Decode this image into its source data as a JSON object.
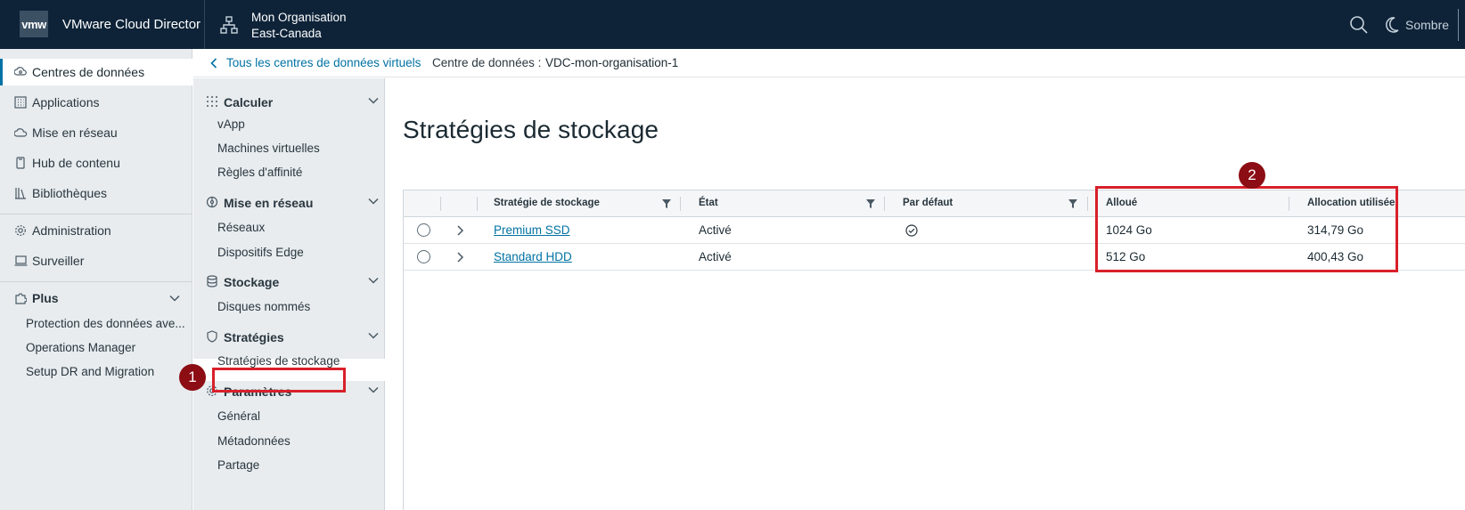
{
  "header": {
    "logo": "vmw",
    "app_name": "VMware Cloud Director",
    "org_line1": "Mon Organisation",
    "org_line2": "East-Canada",
    "theme_label": "Sombre"
  },
  "leftnav": {
    "items": [
      {
        "label": "Centres de données",
        "icon": "datacenter-icon"
      },
      {
        "label": "Applications",
        "icon": "applications-icon"
      },
      {
        "label": "Mise en réseau",
        "icon": "cloud-network-icon"
      },
      {
        "label": "Hub de contenu",
        "icon": "content-hub-icon"
      },
      {
        "label": "Bibliothèques",
        "icon": "libraries-icon"
      },
      {
        "label": "Administration",
        "icon": "gear-icon"
      },
      {
        "label": "Surveiller",
        "icon": "monitor-icon"
      }
    ],
    "plus_label": "Plus",
    "plus_items": [
      "Protection des données ave...",
      "Operations Manager",
      "Setup DR and Migration"
    ]
  },
  "breadcrumb": {
    "back_label": "Tous les centres de données virtuels",
    "dc_label": "Centre de données :",
    "dc_value": "VDC-mon-organisation-1"
  },
  "secnav": {
    "calculer": {
      "title": "Calculer",
      "items": [
        "vApp",
        "Machines virtuelles",
        "Règles d'affinité"
      ]
    },
    "reseau": {
      "title": "Mise en réseau",
      "items": [
        "Réseaux",
        "Dispositifs Edge"
      ]
    },
    "stockage": {
      "title": "Stockage",
      "items": [
        "Disques nommés"
      ]
    },
    "strategies": {
      "title": "Stratégies",
      "items": [
        "Stratégies de stockage"
      ]
    },
    "parametres": {
      "title": "Paramètres",
      "items": [
        "Général",
        "Métadonnées",
        "Partage"
      ]
    }
  },
  "main": {
    "title": "Stratégies de stockage",
    "columns": {
      "policy": "Stratégie de stockage",
      "state": "État",
      "default": "Par défaut",
      "allocated": "Alloué",
      "used": "Allocation utilisée"
    },
    "rows": [
      {
        "policy": "Premium SSD",
        "state": "Activé",
        "is_default": true,
        "allocated": "1024 Go",
        "used": "314,79 Go"
      },
      {
        "policy": "Standard HDD",
        "state": "Activé",
        "is_default": false,
        "allocated": "512 Go",
        "used": "400,43 Go"
      }
    ]
  },
  "annotations": {
    "badge1": "1",
    "badge2": "2",
    "color": "#d8202a"
  },
  "colors": {
    "header_bg": "#0e2338",
    "link": "#0072a3",
    "nav_bg": "#e8ecef"
  }
}
